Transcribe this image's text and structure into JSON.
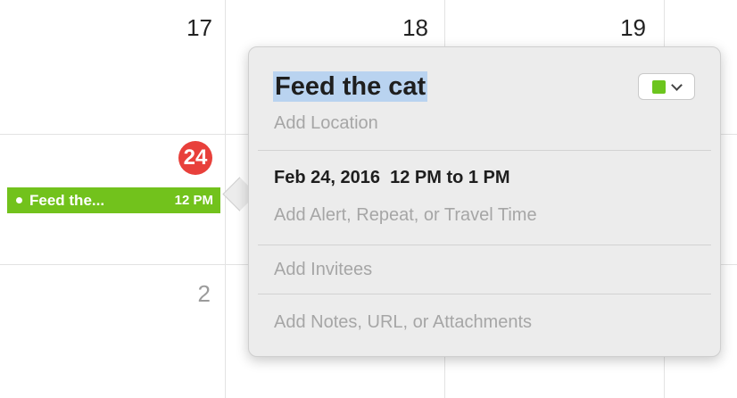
{
  "calendar": {
    "day_headers": [
      "17",
      "18",
      "19"
    ],
    "today_number": "24",
    "next_week_day": "2"
  },
  "event": {
    "title_truncated": "Feed the...",
    "time": "12 PM",
    "color": "#72c21c"
  },
  "popover": {
    "title": "Feed the cat",
    "calendar_color": "#6cc51e",
    "location_placeholder": "Add Location",
    "date_time": "Feb 24, 2016  12 PM to 1 PM",
    "alert_placeholder": "Add Alert, Repeat, or Travel Time",
    "invitees_placeholder": "Add Invitees",
    "notes_placeholder": "Add Notes, URL, or Attachments"
  }
}
